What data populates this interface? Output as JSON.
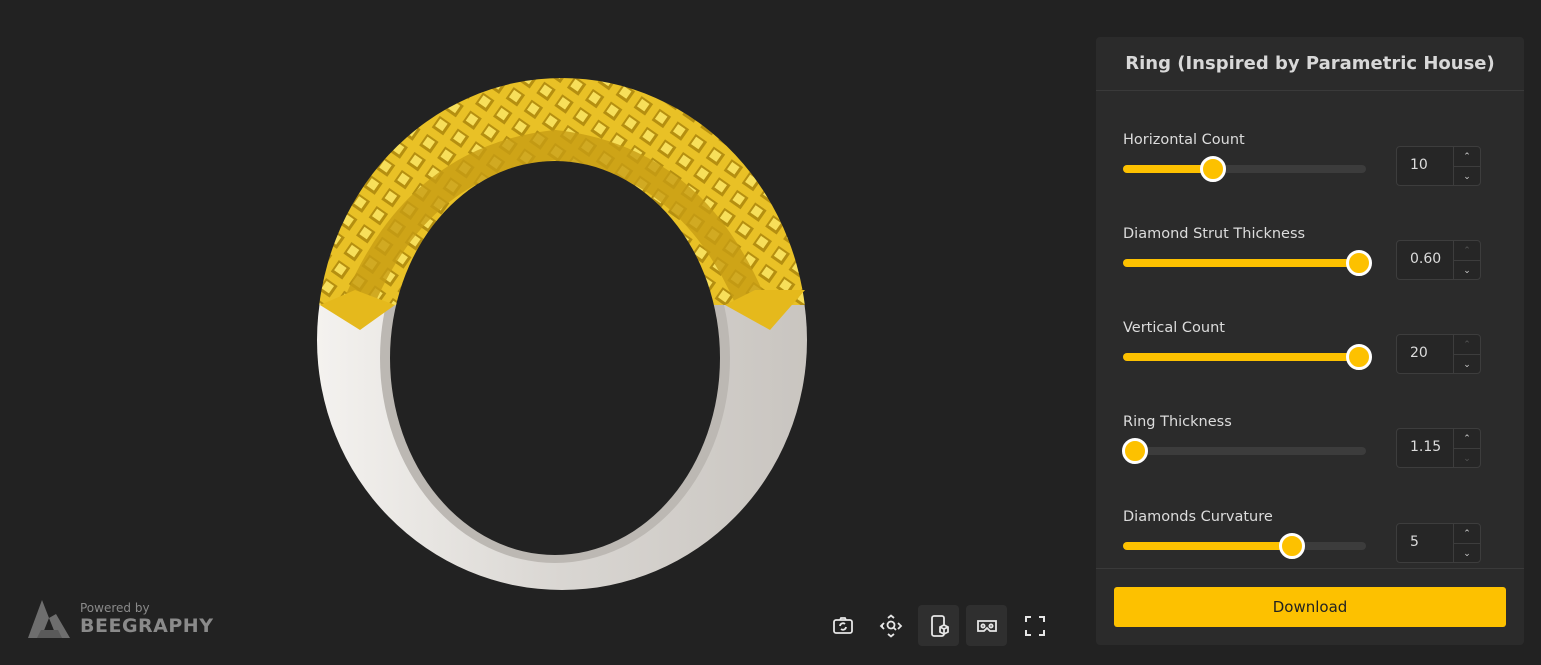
{
  "brand": {
    "powered_by": "Powered by",
    "name": "BEEGRAPHY"
  },
  "toolbar": {
    "buttons": [
      {
        "icon": "camera-reset-icon"
      },
      {
        "icon": "zoom-fit-icon"
      },
      {
        "icon": "ar-view-icon",
        "active": true
      },
      {
        "icon": "vr-headset-icon",
        "active": true
      },
      {
        "icon": "fullscreen-icon"
      }
    ]
  },
  "panel": {
    "title": "Ring (Inspired by Parametric House)",
    "params": [
      {
        "label": "Horizontal Count",
        "value": "10",
        "fraction": 0.35
      },
      {
        "label": "Diamond Strut Thickness",
        "value": "0.60",
        "fraction": 1.0
      },
      {
        "label": "Vertical Count",
        "value": "20",
        "fraction": 1.0
      },
      {
        "label": "Ring Thickness",
        "value": "1.15",
        "fraction": 0.0
      },
      {
        "label": "Diamonds Curvature",
        "value": "5",
        "fraction": 0.7
      }
    ],
    "download_label": "Download"
  },
  "colors": {
    "accent": "#fdc100",
    "background": "#222222",
    "panel": "#2b2b2b",
    "gold": "#e7bb1f",
    "silver": "#e4e1dd"
  }
}
